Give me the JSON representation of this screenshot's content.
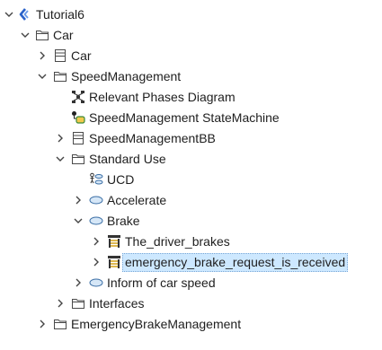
{
  "tree": {
    "nodes": [
      {
        "label": "Tutorial6",
        "icon": "project-icon",
        "expander": "expanded"
      },
      {
        "label": "Car",
        "icon": "folder-icon",
        "expander": "expanded"
      },
      {
        "label": "Car",
        "icon": "block-icon",
        "expander": "collapsed"
      },
      {
        "label": "SpeedManagement",
        "icon": "folder-icon",
        "expander": "expanded"
      },
      {
        "label": "Relevant Phases Diagram",
        "icon": "phases-diagram-icon",
        "expander": "none"
      },
      {
        "label": "SpeedManagement StateMachine",
        "icon": "state-machine-icon",
        "expander": "none"
      },
      {
        "label": "SpeedManagementBB",
        "icon": "block-icon",
        "expander": "collapsed"
      },
      {
        "label": "Standard Use",
        "icon": "folder-icon",
        "expander": "expanded"
      },
      {
        "label": "UCD",
        "icon": "use-case-diagram-icon",
        "expander": "none"
      },
      {
        "label": "Accelerate",
        "icon": "use-case-icon",
        "expander": "collapsed"
      },
      {
        "label": "Brake",
        "icon": "use-case-icon",
        "expander": "expanded"
      },
      {
        "label": "The_driver_brakes",
        "icon": "scenario-icon",
        "expander": "collapsed"
      },
      {
        "label": "emergency_brake_request_is_received",
        "icon": "scenario-icon",
        "expander": "collapsed",
        "selected": true
      },
      {
        "label": "Inform of car speed",
        "icon": "use-case-icon",
        "expander": "collapsed"
      },
      {
        "label": "Interfaces",
        "icon": "folder-icon",
        "expander": "collapsed"
      },
      {
        "label": "EmergencyBrakeManagement",
        "icon": "folder-icon",
        "expander": "collapsed"
      }
    ]
  },
  "colors": {
    "selection_background": "#cde8ff",
    "chevron": "#444444",
    "folder": "#4a4a4a",
    "use_case_fill": "#d6e7f7",
    "use_case_stroke": "#3a6ea5",
    "project_blue": "#2a62c9"
  }
}
